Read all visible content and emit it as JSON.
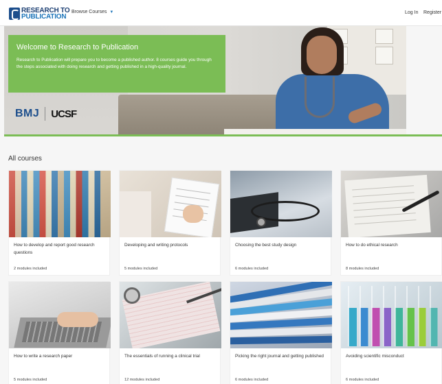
{
  "header": {
    "logo_line1": "RESEARCH TO",
    "logo_line2": "PUBLICATION",
    "browse_label": "Browse Courses",
    "login_label": "Log In",
    "register_label": "Register"
  },
  "hero": {
    "title": "Welcome to Research to Publication",
    "text": "Research to Publication will prepare you to become a published author. 8 courses guide you through the steps associated with doing research and getting published in a high-quality journal.",
    "partner1": "BMJ",
    "partner2": "UCSF"
  },
  "colors": {
    "accent": "#7bbd55",
    "brand": "#1c4e8c"
  },
  "courses": {
    "heading": "All courses",
    "items": [
      {
        "title": "How to develop and report good research questions",
        "meta": "2 modules included"
      },
      {
        "title": "Developing and writing protocols",
        "meta": "5 modules included"
      },
      {
        "title": "Choosing the best study design",
        "meta": "6 modules included"
      },
      {
        "title": "How to do ethical research",
        "meta": "8 modules included"
      },
      {
        "title": "How to write a research paper",
        "meta": "5 modules included"
      },
      {
        "title": "The essentials of running a clinical trial",
        "meta": "12 modules included"
      },
      {
        "title": "Picking the right journal and getting published",
        "meta": "6 modules included"
      },
      {
        "title": "Avoiding scientific misconduct",
        "meta": "6 modules included"
      }
    ]
  }
}
